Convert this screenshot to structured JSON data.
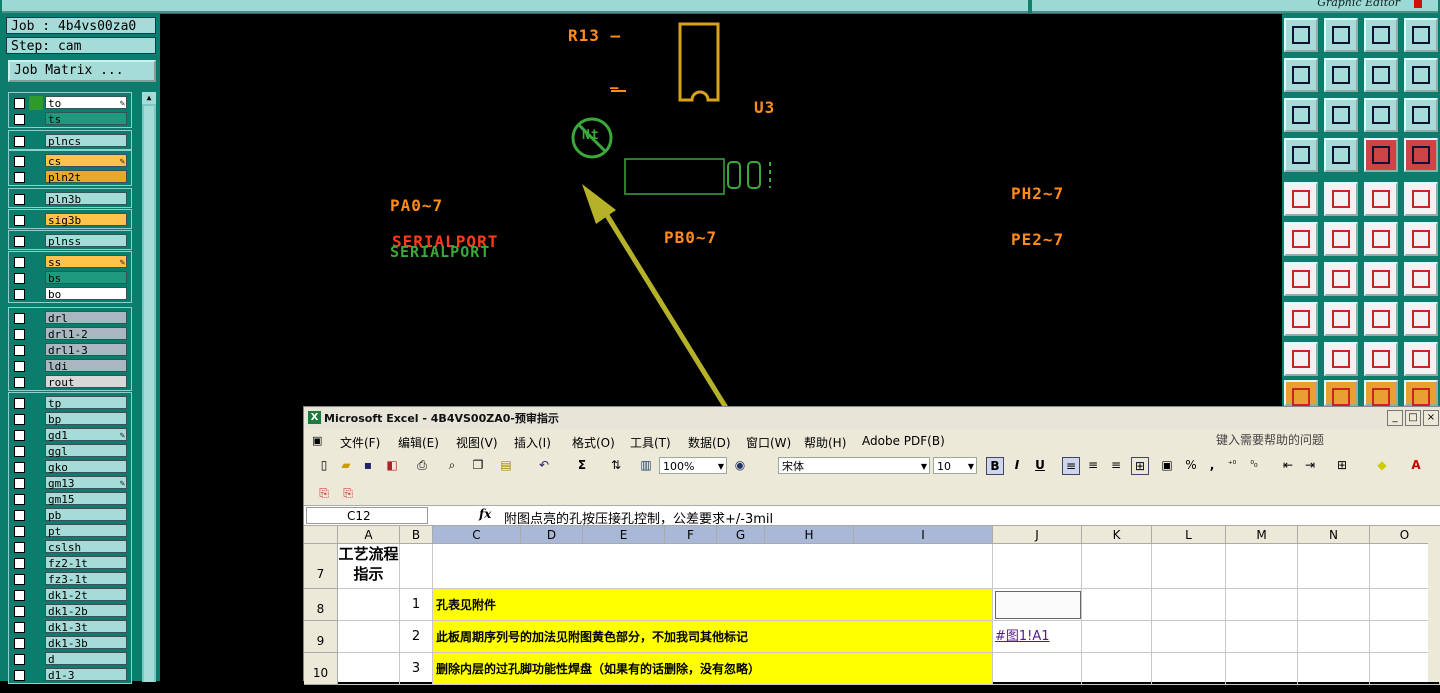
{
  "window": {
    "app_title": "Graphic Editor"
  },
  "left_panel": {
    "job_label": "Job : 4b4vs00za0",
    "step_label": "Step: cam",
    "job_matrix_button": "Job Matrix ...",
    "layers": [
      {
        "name": "to",
        "bg": "#ffffff",
        "mark": "#2e9a2e",
        "edit": true
      },
      {
        "name": "ts",
        "bg": "#1f9a7e",
        "mark": "",
        "edit": false
      },
      {
        "name": "plncs",
        "bg": "#a6dcd8",
        "mark": "",
        "edit": false
      },
      {
        "name": "cs",
        "bg": "#ffc24a",
        "mark": "",
        "edit": true
      },
      {
        "name": "pln2t",
        "bg": "#e8a82a",
        "mark": "",
        "edit": false
      },
      {
        "name": "pln3b",
        "bg": "#a6dcd8",
        "mark": "",
        "edit": false
      },
      {
        "name": "sig3b",
        "bg": "#ffc24a",
        "mark": "",
        "edit": false
      },
      {
        "name": "plnss",
        "bg": "#a6dcd8",
        "mark": "",
        "edit": false
      },
      {
        "name": "ss",
        "bg": "#ffc24a",
        "mark": "",
        "edit": true
      },
      {
        "name": "bs",
        "bg": "#1f9a7e",
        "mark": "",
        "edit": false
      },
      {
        "name": "bo",
        "bg": "#ffffff",
        "mark": "",
        "edit": false
      },
      {
        "name": "drl",
        "bg": "#a9b8c0",
        "mark": "",
        "edit": false
      },
      {
        "name": "drl1-2",
        "bg": "#a9b8c0",
        "mark": "",
        "edit": false
      },
      {
        "name": "drl1-3",
        "bg": "#a9b8c0",
        "mark": "",
        "edit": false
      },
      {
        "name": "ldi",
        "bg": "#a9b8c0",
        "mark": "",
        "edit": false
      },
      {
        "name": "rout",
        "bg": "#d8d8d8",
        "mark": "",
        "edit": false
      },
      {
        "name": "tp",
        "bg": "#a6dcd8",
        "mark": "",
        "edit": false
      },
      {
        "name": "bp",
        "bg": "#a6dcd8",
        "mark": "",
        "edit": false
      },
      {
        "name": "gd1",
        "bg": "#a6dcd8",
        "mark": "",
        "edit": true
      },
      {
        "name": "ggl",
        "bg": "#a6dcd8",
        "mark": "",
        "edit": false
      },
      {
        "name": "gko",
        "bg": "#a6dcd8",
        "mark": "",
        "edit": false
      },
      {
        "name": "gm13",
        "bg": "#a6dcd8",
        "mark": "",
        "edit": true
      },
      {
        "name": "gm15",
        "bg": "#a6dcd8",
        "mark": "",
        "edit": false
      },
      {
        "name": "pb",
        "bg": "#a6dcd8",
        "mark": "",
        "edit": false
      },
      {
        "name": "pt",
        "bg": "#a6dcd8",
        "mark": "",
        "edit": false
      },
      {
        "name": "cslsh",
        "bg": "#a6dcd8",
        "mark": "",
        "edit": false
      },
      {
        "name": "fz2-1t",
        "bg": "#a6dcd8",
        "mark": "",
        "edit": false
      },
      {
        "name": "fz3-1t",
        "bg": "#a6dcd8",
        "mark": "",
        "edit": false
      },
      {
        "name": "dk1-2t",
        "bg": "#a6dcd8",
        "mark": "",
        "edit": false
      },
      {
        "name": "dk1-2b",
        "bg": "#a6dcd8",
        "mark": "",
        "edit": false
      },
      {
        "name": "dk1-3t",
        "bg": "#a6dcd8",
        "mark": "",
        "edit": false
      },
      {
        "name": "dk1-3b",
        "bg": "#a6dcd8",
        "mark": "",
        "edit": false
      },
      {
        "name": "d",
        "bg": "#a6dcd8",
        "mark": "",
        "edit": false
      },
      {
        "name": "d1-3",
        "bg": "#a6dcd8",
        "mark": "",
        "edit": false
      }
    ]
  },
  "canvas": {
    "labels": [
      {
        "id": "r13",
        "text": "R13 —",
        "color": "#ff8c1a"
      },
      {
        "id": "u3",
        "text": "U3",
        "color": "#ff8c1a"
      },
      {
        "id": "pa07",
        "text": "PA0~7",
        "color": "#ff8c1a"
      },
      {
        "id": "pb07",
        "text": "PB0~7",
        "color": "#ff8c1a"
      },
      {
        "id": "ph27",
        "text": "PH2~7",
        "color": "#ff8c1a"
      },
      {
        "id": "pe27",
        "text": "PE2~7",
        "color": "#ff8c1a"
      },
      {
        "id": "serial1",
        "text": "SERIALPORT",
        "color": "#ff3b1a"
      },
      {
        "id": "serial2",
        "text": "SERIALPORT",
        "color": "#3aa83a"
      },
      {
        "id": "nt",
        "text": "Nt",
        "color": "#3aa83a"
      },
      {
        "id": "dash",
        "text": "—",
        "color": "#ff8c1a"
      }
    ]
  },
  "excel": {
    "title": "Microsoft Excel - 4B4VS00ZA0-预审指示",
    "menus": [
      "文件(F)",
      "编辑(E)",
      "视图(V)",
      "插入(I)",
      "格式(O)",
      "工具(T)",
      "数据(D)",
      "窗口(W)",
      "帮助(H)",
      "Adobe PDF(B)"
    ],
    "help_placeholder": "键入需要帮助的问题",
    "zoom": "100%",
    "font_name": "宋体",
    "font_size": "10",
    "name_box": "C12",
    "fx": "fx",
    "formula": "附图点亮的孔按压接孔控制，公差要求+/-3mil",
    "columns": [
      "A",
      "B",
      "C",
      "D",
      "E",
      "F",
      "G",
      "H",
      "I",
      "J",
      "K",
      "L",
      "M",
      "N",
      "O"
    ],
    "rows": [
      {
        "num": "7",
        "a": "工艺流程指示",
        "b": "",
        "c": "",
        "j": ""
      },
      {
        "num": "8",
        "a": "",
        "b": "1",
        "c": "孔表见附件",
        "j": ""
      },
      {
        "num": "9",
        "a": "",
        "b": "2",
        "c": "此板周期序列号的加法见附图黄色部分，不加我司其他标记",
        "j": "#图1!A1"
      },
      {
        "num": "10",
        "a": "",
        "b": "3",
        "c": "删除内层的过孔脚功能性焊盘（如果有的话删除，没有忽略）",
        "j": ""
      }
    ],
    "toolbar_glyphs": {
      "sum": "Σ",
      "bold": "B",
      "italic": "I",
      "underline": "U",
      "percent": "%",
      "comma": ","
    }
  }
}
